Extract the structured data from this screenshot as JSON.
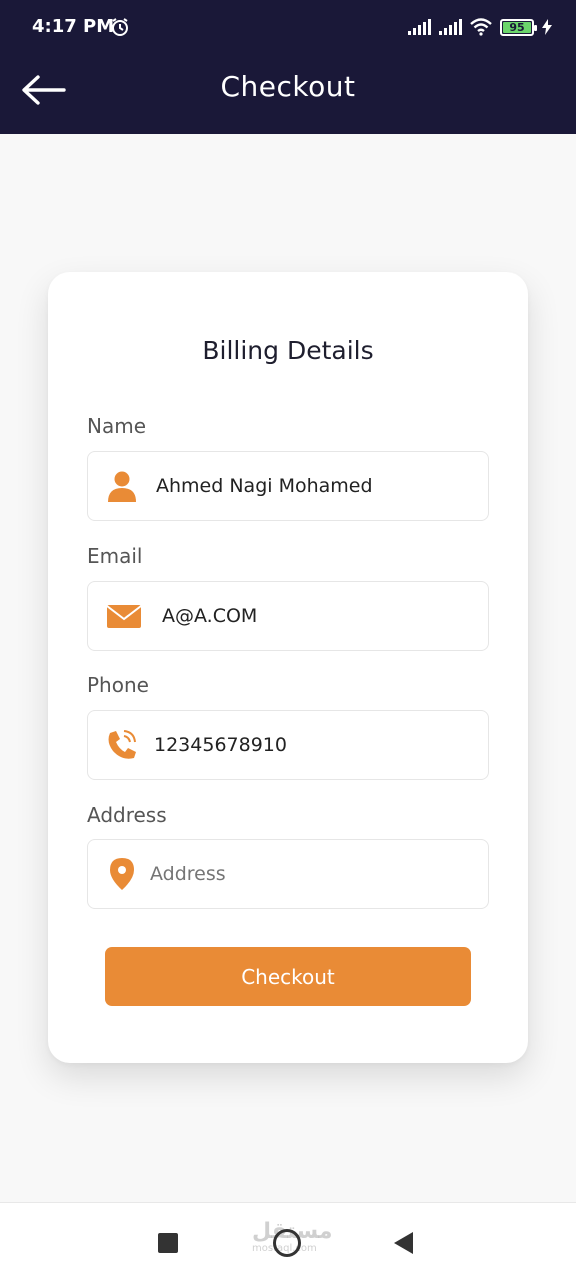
{
  "status_bar": {
    "time": "4:17 PM",
    "battery": "95",
    "icons": [
      "alarm-icon",
      "signal-icon",
      "signal-icon",
      "wifi-icon",
      "battery-icon",
      "charging-icon"
    ]
  },
  "app_bar": {
    "title": "Checkout",
    "back_icon": "arrow-left-icon"
  },
  "card": {
    "title": "Billing Details",
    "fields": [
      {
        "label": "Name",
        "value": "Ahmed Nagi Mohamed",
        "placeholder": "",
        "icon": "person-icon"
      },
      {
        "label": "Email",
        "value": "A@A.COM",
        "placeholder": "",
        "icon": "envelope-icon"
      },
      {
        "label": "Phone",
        "value": "12345678910",
        "placeholder": "",
        "icon": "phone-icon"
      },
      {
        "label": "Address",
        "value": "",
        "placeholder": "Address",
        "icon": "location-pin-icon"
      }
    ],
    "button_label": "Checkout"
  },
  "nav_bar": {
    "watermark": "مستقل",
    "watermark_sub": "mostaql.com"
  },
  "colors": {
    "header_bg": "#1a1838",
    "accent": "#e98b36",
    "page_bg": "#f8f8f8"
  }
}
